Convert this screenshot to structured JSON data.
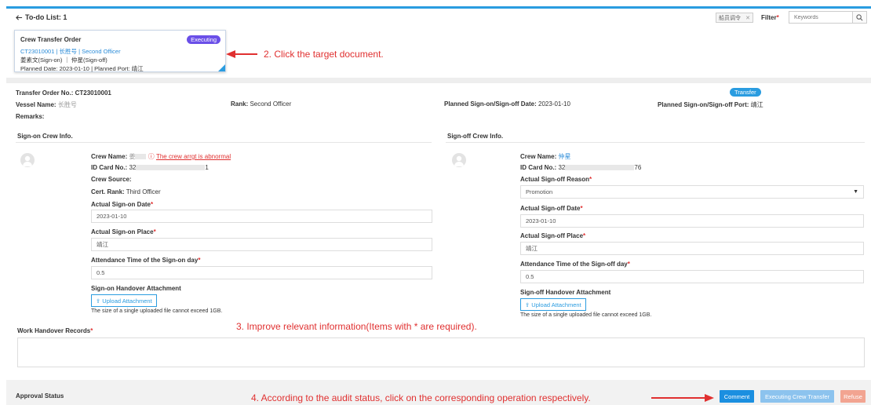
{
  "header": {
    "back_label": "To-do List: 1",
    "tag_filter": "船员调令",
    "filter_label": "Filter",
    "keywords_placeholder": "Keywords"
  },
  "card": {
    "title": "Crew Transfer Order",
    "status": "Executing",
    "order_no": "CT23010001",
    "vessel": "长胜号",
    "rank": "Second Officer",
    "crew_line": "姜素文(Sign-on) ｜ 仲星(Sign-off)",
    "planned_line": "Planned Date: 2023-01-10 | Planned Port: 靖江"
  },
  "annotations": {
    "step2": "2. Click the target document.",
    "step3": "3. Improve relevant information(Items with * are required).",
    "step4": "4. According to the audit status, click on the corresponding operation respectively."
  },
  "order": {
    "no_label": "Transfer Order No.:",
    "no_value": "CT23010001",
    "badge": "Transfer",
    "vessel_label": "Vessel Name:",
    "vessel_value": "长胜号",
    "rank_label": "Rank:",
    "rank_value": "Second Officer",
    "date_label": "Planned Sign-on/Sign-off Date:",
    "date_value": "2023-01-10",
    "port_label": "Planned Sign-on/Sign-off Port:",
    "port_value": "靖江",
    "remarks_label": "Remarks:"
  },
  "signon": {
    "section": "Sign-on Crew Info.",
    "name_label": "Crew Name:",
    "name_value": "姜",
    "name_warning": "The crew arrgt is abnormal",
    "id_label": "ID Card No.:",
    "id_prefix": "32",
    "id_suffix": "1",
    "source_label": "Crew Source:",
    "cert_label": "Cert. Rank:",
    "cert_value": "Third Officer",
    "date_label": "Actual Sign-on Date",
    "date_value": "2023-01-10",
    "place_label": "Actual Sign-on Place",
    "place_value": "靖江",
    "attendance_label": "Attendance Time of the Sign-on day",
    "attendance_value": "0.5",
    "attach_label": "Sign-on Handover Attachment",
    "upload_label": "Upload Attachment",
    "hint": "The size of a single uploaded file cannot exceed 1GB."
  },
  "signoff": {
    "section": "Sign-off Crew Info.",
    "name_label": "Crew Name:",
    "name_value": "仲星",
    "id_label": "ID Card No.:",
    "id_prefix": "32",
    "id_suffix": "76",
    "reason_label": "Actual Sign-off Reason",
    "reason_value": "Promotion",
    "date_label": "Actual Sign-off Date",
    "date_value": "2023-01-10",
    "place_label": "Actual Sign-off Place",
    "place_value": "靖江",
    "attendance_label": "Attendance Time of the Sign-off day",
    "attendance_value": "0.5",
    "attach_label": "Sign-off Handover Attachment",
    "upload_label": "Upload Attachment",
    "hint": "The size of a single uploaded file cannot exceed 1GB."
  },
  "work": {
    "label": "Work Handover Records"
  },
  "footer": {
    "approval_label": "Approval Status",
    "comment": "Comment",
    "execute": "Executing Crew Transfer",
    "refuse": "Refuse"
  },
  "colors": {
    "accent": "#2a9ce0",
    "executing_badge": "#6a4fe8",
    "annotation": "#e03030",
    "comment_btn": "#1b8fe0",
    "execute_btn": "#8cc3ee",
    "refuse_btn": "#f2a491"
  }
}
